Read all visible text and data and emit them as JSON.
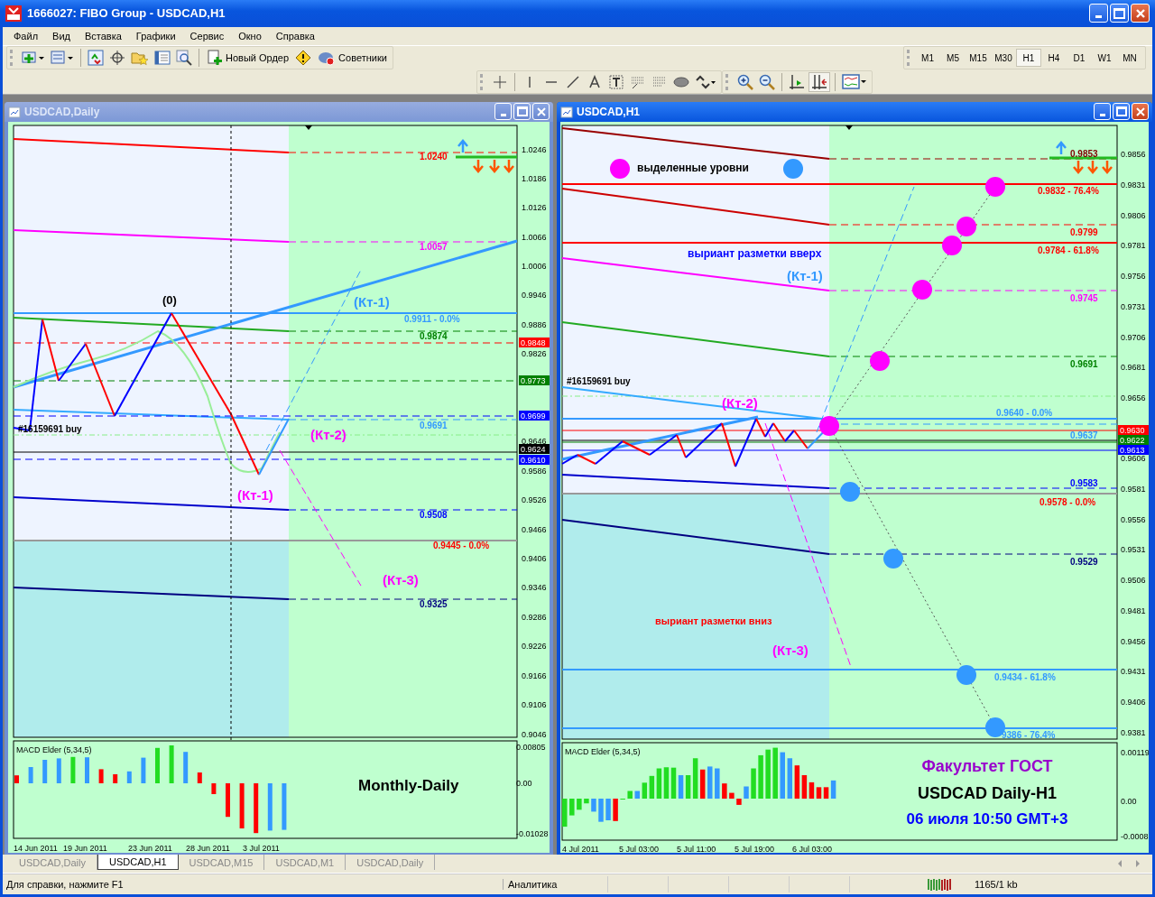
{
  "window": {
    "title": "1666027: FIBO Group - USDCAD,H1"
  },
  "menu": [
    "Файл",
    "Вид",
    "Вставка",
    "Графики",
    "Сервис",
    "Окно",
    "Справка"
  ],
  "toolbar": {
    "new_order": "Новый Ордер",
    "experts": "Советники"
  },
  "timeframes": [
    {
      "label": "M1",
      "selected": false
    },
    {
      "label": "M5",
      "selected": false
    },
    {
      "label": "M15",
      "selected": false
    },
    {
      "label": "M30",
      "selected": false
    },
    {
      "label": "H1",
      "selected": true
    },
    {
      "label": "H4",
      "selected": false
    },
    {
      "label": "D1",
      "selected": false
    },
    {
      "label": "W1",
      "selected": false
    },
    {
      "label": "MN",
      "selected": false
    }
  ],
  "charts": [
    {
      "title": "USDCAD,Daily",
      "active": false,
      "y_ticks": [
        "1.0246",
        "1.0186",
        "1.0126",
        "1.0066",
        "1.0006",
        "0.9946",
        "0.9886",
        "0.9826",
        "0.9646",
        "0.9586",
        "0.9526",
        "0.9466",
        "0.9406",
        "0.9346",
        "0.9286",
        "0.9226",
        "0.9166",
        "0.9106",
        "0.9046"
      ],
      "levels": [
        {
          "text": "1.0240",
          "color": "#ff0000"
        },
        {
          "text": "1.0057",
          "color": "#ff00ff"
        },
        {
          "text": "0.9911 - 0.0%",
          "color": "#3399ff"
        },
        {
          "text": "0.9874",
          "color": "#008000"
        },
        {
          "text": "0.9691",
          "color": "#3399ff"
        },
        {
          "text": "0.9508",
          "color": "#0000ff"
        },
        {
          "text": "0.9445 - 0.0%",
          "color": "#ff0000"
        },
        {
          "text": "0.9325",
          "color": "#000080"
        },
        {
          "text": "#16159691 buy",
          "color": "#000000"
        }
      ],
      "price_tags": [
        {
          "text": "0.9848",
          "color": "#ff0000"
        },
        {
          "text": "0.9773",
          "color": "#008000"
        },
        {
          "text": "0.9699",
          "color": "#0000ff"
        },
        {
          "text": "0.9624",
          "color": "#000000"
        },
        {
          "text": "0.9610",
          "color": "#0000ff"
        }
      ],
      "notes": [
        {
          "text": "(0)",
          "color": "#000000"
        },
        {
          "text": "(Кт-1)",
          "color": "#3399ff"
        },
        {
          "text": "(Кт-2)",
          "color": "#ff00ff"
        },
        {
          "text": "(Кт-1)",
          "color": "#ff00ff"
        },
        {
          "text": "(Кт-3)",
          "color": "#ff00ff"
        }
      ],
      "indicator": {
        "label": "MACD Elder (5,34,5)",
        "y_ticks": [
          "0.00805",
          "0.00",
          "-0.01028"
        ],
        "captions": [
          {
            "text": "Monthly-Daily",
            "color": "#000000"
          }
        ]
      },
      "x_ticks": [
        "14 Jun 2011",
        "19 Jun 2011",
        "23 Jun 2011",
        "28 Jun 2011",
        "3 Jul 2011"
      ]
    },
    {
      "title": "USDCAD,H1",
      "active": true,
      "y_ticks": [
        "0.9856",
        "0.9831",
        "0.9806",
        "0.9781",
        "0.9756",
        "0.9731",
        "0.9706",
        "0.9681",
        "0.9656",
        "0.9606",
        "0.9581",
        "0.9556",
        "0.9531",
        "0.9506",
        "0.9481",
        "0.9456",
        "0.9431",
        "0.9406",
        "0.9381"
      ],
      "levels": [
        {
          "text": "0.9853",
          "color": "#800000"
        },
        {
          "text": "0.9832 - 76.4%",
          "color": "#ff0000"
        },
        {
          "text": "0.9799",
          "color": "#ff0000"
        },
        {
          "text": "0.9784 - 61.8%",
          "color": "#ff0000"
        },
        {
          "text": "0.9745",
          "color": "#ff00ff"
        },
        {
          "text": "0.9691",
          "color": "#008000"
        },
        {
          "text": "0.9640 - 0.0%",
          "color": "#3399ff"
        },
        {
          "text": "0.9637",
          "color": "#3399ff"
        },
        {
          "text": "0.9583",
          "color": "#0000ff"
        },
        {
          "text": "0.9578 - 0.0%",
          "color": "#ff0000"
        },
        {
          "text": "0.9529",
          "color": "#000080"
        },
        {
          "text": "0.9434 - 61.8%",
          "color": "#3399ff"
        },
        {
          "text": "9386 - 76.4%",
          "color": "#3399ff"
        },
        {
          "text": "#16159691 buy",
          "color": "#000000"
        }
      ],
      "price_tags": [
        {
          "text": "0.9630",
          "color": "#ff0000"
        },
        {
          "text": "0.9622",
          "color": "#008000"
        },
        {
          "text": "0.9613",
          "color": "#0000ff"
        }
      ],
      "notes": [
        {
          "text": "выделенные уровни",
          "color": "#000000"
        },
        {
          "text": "выриант разметки вверх",
          "color": "#0000ff"
        },
        {
          "text": "(Кт-1)",
          "color": "#3399ff"
        },
        {
          "text": "(Кт-2)",
          "color": "#ff00ff"
        },
        {
          "text": "выриант разметки вниз",
          "color": "#ff0000"
        },
        {
          "text": "(Кт-3)",
          "color": "#ff00ff"
        }
      ],
      "indicator": {
        "label": "MACD Elder (5,34,5)",
        "y_ticks": [
          "0.00119",
          "0.00",
          "-0.0008"
        ],
        "captions": [
          {
            "text": "Факультет ГОСТ",
            "color": "#9900cc"
          },
          {
            "text": "USDCAD Daily-H1",
            "color": "#000000"
          },
          {
            "text": "06 июля 10:50 GMT+3",
            "color": "#0000ff"
          }
        ]
      },
      "x_ticks": [
        "4 Jul 2011",
        "5 Jul 03:00",
        "5 Jul 11:00",
        "5 Jul 19:00",
        "6 Jul 03:00"
      ]
    }
  ],
  "chart_tabs": [
    {
      "label": "USDCAD,Daily",
      "selected": false
    },
    {
      "label": "USDCAD,H1",
      "selected": true
    },
    {
      "label": "USDCAD,M15",
      "selected": false
    },
    {
      "label": "USDCAD,M1",
      "selected": false
    },
    {
      "label": "USDCAD,Daily",
      "selected": false
    }
  ],
  "status_bar": {
    "help": "Для справки, нажмите F1",
    "profile": "Аналитика",
    "traffic": "1165/1 kb"
  }
}
